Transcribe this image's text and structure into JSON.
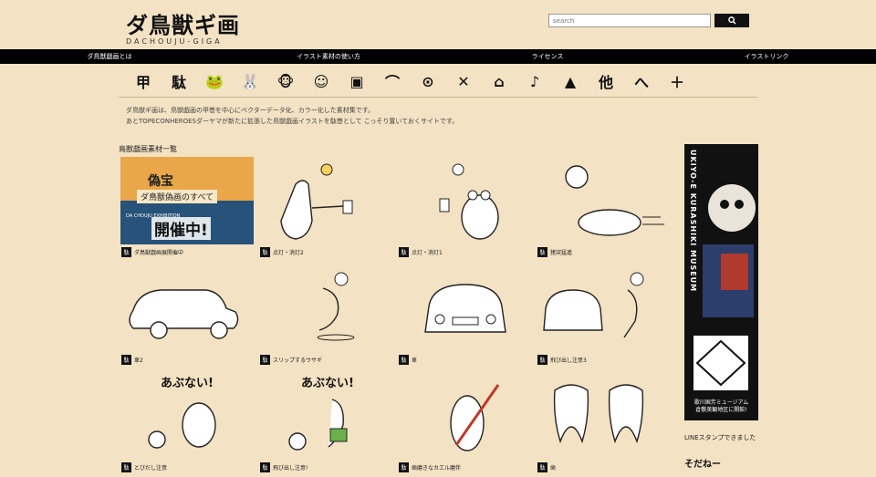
{
  "site": {
    "logo_title": "ダ鳥獣ギ画",
    "logo_sub": "DACHOUJU-GIGA"
  },
  "search": {
    "placeholder": "search"
  },
  "nav": [
    "ダ鳥獣戯画とは",
    "イラスト素材の使い方",
    "ライセンス",
    "イラストリンク"
  ],
  "categories": [
    {
      "glyph": "甲",
      "name": "kou-category-icon"
    },
    {
      "glyph": "駄",
      "name": "da-category-icon"
    },
    {
      "glyph": "🐸",
      "name": "frog-icon"
    },
    {
      "glyph": "🐰",
      "name": "rabbit-icon"
    },
    {
      "glyph": "🐵",
      "name": "monkey-icon"
    },
    {
      "glyph": "☺",
      "name": "smile-face-icon"
    },
    {
      "glyph": "▣",
      "name": "bag-icon"
    },
    {
      "glyph": "⌒",
      "name": "onsen-icon"
    },
    {
      "glyph": "⊙",
      "name": "ball-icon"
    },
    {
      "glyph": "✕",
      "name": "crossed-swords-icon"
    },
    {
      "glyph": "⌂",
      "name": "house-icon"
    },
    {
      "glyph": "♪",
      "name": "music-note-icon"
    },
    {
      "glyph": "▲",
      "name": "mountain-icon"
    },
    {
      "glyph": "他",
      "name": "other-category-icon"
    },
    {
      "glyph": "へ",
      "name": "he-icon"
    },
    {
      "glyph": "＋",
      "name": "plus-icon"
    }
  ],
  "intro": {
    "line1": "ダ鳥獣ギ画は、鳥獣戯画の甲巻を中心にベクターデータ化、カラー化した素材集です。",
    "line2": "あとTOPECONHEROESダーヤマが新たに拡張した鳥獣戯画イラストを駄巻として こっそり置いておくサイトです。"
  },
  "section_title": "鳥獣戯画素材一覧",
  "badge": "駄",
  "cards": [
    {
      "label": "ダ鳥獣戯画展開催中"
    },
    {
      "label": "点灯・消灯2"
    },
    {
      "label": "点灯・消灯1"
    },
    {
      "label": "猪突猛進"
    },
    {
      "label": "車2"
    },
    {
      "label": "スリップするウサギ"
    },
    {
      "label": "車"
    },
    {
      "label": "飛び出し注意3"
    },
    {
      "label": "とびだし注意"
    },
    {
      "label": "飛び出し注意!"
    },
    {
      "label": "歯磨きなカエル磨伴"
    },
    {
      "label": "歯"
    }
  ],
  "exhibit": {
    "text1": "偽宝",
    "text2": "ダ鳥獣偽画のすべて",
    "text3": "DA CHOUJU EXHIBITION",
    "text4": "開催中!"
  },
  "sidebar": {
    "banner_vertical": "UKIYO-E KURASHIKI MUSEUM",
    "banner_caption": "歌川国芳ミュージアム\n倉敷美観地区に開館!",
    "line_text": "LINEスタンプできました",
    "line_sticker": "そだねー"
  },
  "colors": {
    "background": "#f3e2c3",
    "nav": "#000000",
    "exhibit": "#e9a74a"
  }
}
